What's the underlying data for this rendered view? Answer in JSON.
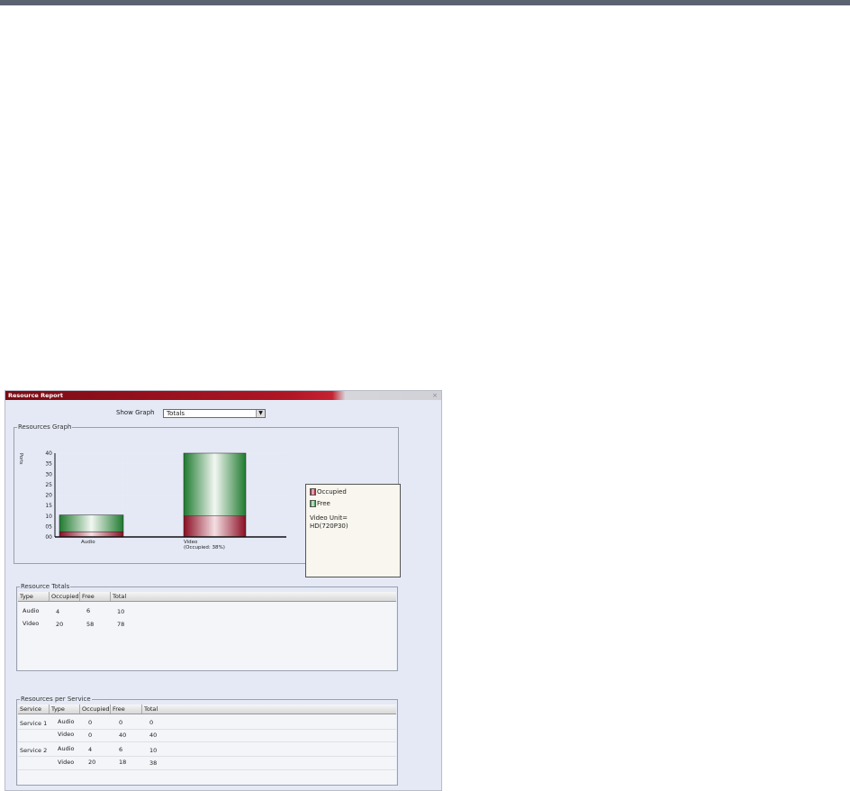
{
  "window": {
    "title": "Resource Report"
  },
  "show_graph": {
    "label": "Show Graph",
    "value": "Totals"
  },
  "graph": {
    "group_title": "Resources Graph",
    "y_axis_label": "Ports",
    "y_ticks": [
      "40",
      "35",
      "30",
      "25",
      "20",
      "15",
      "10",
      "05",
      "00"
    ],
    "legend": {
      "occupied": "Occupied",
      "free": "Free",
      "note_line1": "Video Unit=",
      "note_line2": "HD(720P30)"
    },
    "colors": {
      "occupied": "#a0102a",
      "free": "#2f8f3f"
    }
  },
  "chart_data": {
    "type": "bar",
    "categories": [
      "Audio",
      "Video"
    ],
    "category_labels": [
      [
        "Audio"
      ],
      [
        "Video",
        "(Occupied: 38%)"
      ]
    ],
    "series": [
      {
        "name": "Occupied",
        "values": [
          2.5,
          10
        ]
      },
      {
        "name": "Free",
        "values": [
          8,
          30
        ]
      }
    ],
    "ylabel": "Ports",
    "ylim": [
      0,
      40
    ],
    "stacked": true
  },
  "totals": {
    "group_title": "Resource Totals",
    "columns": [
      "Type",
      "Occupied",
      "Free",
      "Total"
    ],
    "rows": [
      [
        "Audio",
        "4",
        "6",
        "10"
      ],
      [
        "Video",
        "20",
        "58",
        "78"
      ]
    ]
  },
  "per_service": {
    "group_title": "Resources per Service",
    "columns": [
      "Service",
      "Type",
      "Occupied",
      "Free",
      "Total"
    ],
    "rows": [
      [
        "Service 1",
        "Audio",
        "0",
        "0",
        "0"
      ],
      [
        "",
        "Video",
        "0",
        "40",
        "40"
      ],
      [
        "Service 2",
        "Audio",
        "4",
        "6",
        "10"
      ],
      [
        "",
        "Video",
        "20",
        "18",
        "38"
      ]
    ]
  }
}
